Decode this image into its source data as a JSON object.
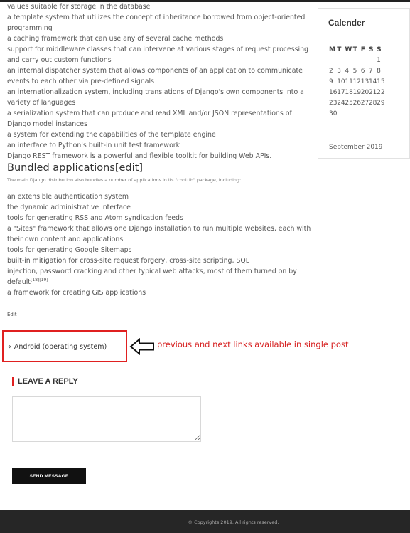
{
  "article": {
    "features": [
      "values suitable for storage in the database",
      "a template system that utilizes the concept of inheritance borrowed from object-oriented programming",
      "a caching framework that can use any of several cache methods",
      "support for middleware classes that can intervene at various stages of request processing and carry out custom functions",
      "an internal dispatcher system that allows components of an application to communicate events to each other via pre-defined signals",
      "an internationalization system, including translations of Django's own components into a variety of languages",
      "a serialization system that can produce and read XML and/or JSON representations of Django model instances",
      "a system for extending the capabilities of the template engine",
      "an interface to Python's built-in unit test framework",
      "Django REST framework is a powerful and flexible toolkit for building Web APIs."
    ],
    "bundled_heading": "Bundled applications[edit]",
    "bundled_intro": "The main Django distribution also bundles a number of applications in its \"contrib\" package, including:",
    "apps": [
      "an extensible authentication system",
      "the dynamic administrative interface",
      "tools for generating RSS and Atom syndication feeds",
      "a \"Sites\" framework that allows one Django installation to run multiple websites, each with their own content and applications",
      "tools for generating Google Sitemaps",
      "built-in mitigation for cross-site request forgery, cross-site scripting, SQL",
      "injection, password cracking and other typical web attacks, most of them turned on by default",
      "a framework for creating GIS applications"
    ],
    "footnote_refs": "[18][19]",
    "edit_link": "Edit"
  },
  "sidebar": {
    "title": "Calender",
    "weekdays": [
      "M",
      "T",
      "W",
      "T",
      "F",
      "S",
      "S"
    ],
    "weeks": [
      [
        "",
        "",
        "",
        "",
        "",
        "",
        "1"
      ],
      [
        "2",
        "3",
        "4",
        "5",
        "6",
        "7",
        "8"
      ],
      [
        "9",
        "10",
        "11",
        "12",
        "13",
        "14",
        "15"
      ],
      [
        "16",
        "17",
        "18",
        "19",
        "20",
        "21",
        "22"
      ],
      [
        "23",
        "24",
        "25",
        "26",
        "27",
        "28",
        "29"
      ],
      [
        "30",
        "",
        "",
        "",
        "",
        "",
        ""
      ]
    ],
    "month": "September 2019"
  },
  "navigation": {
    "prev_link": "« Android (operating system)"
  },
  "annotation": {
    "text": "previous and next links available in single post",
    "color": "#d62020"
  },
  "reply": {
    "heading": "LEAVE A REPLY",
    "textarea_value": "",
    "send_label": "SEND MESSAGE"
  },
  "footer": {
    "copyright": "© Copyrights 2019. All rights reserved."
  }
}
